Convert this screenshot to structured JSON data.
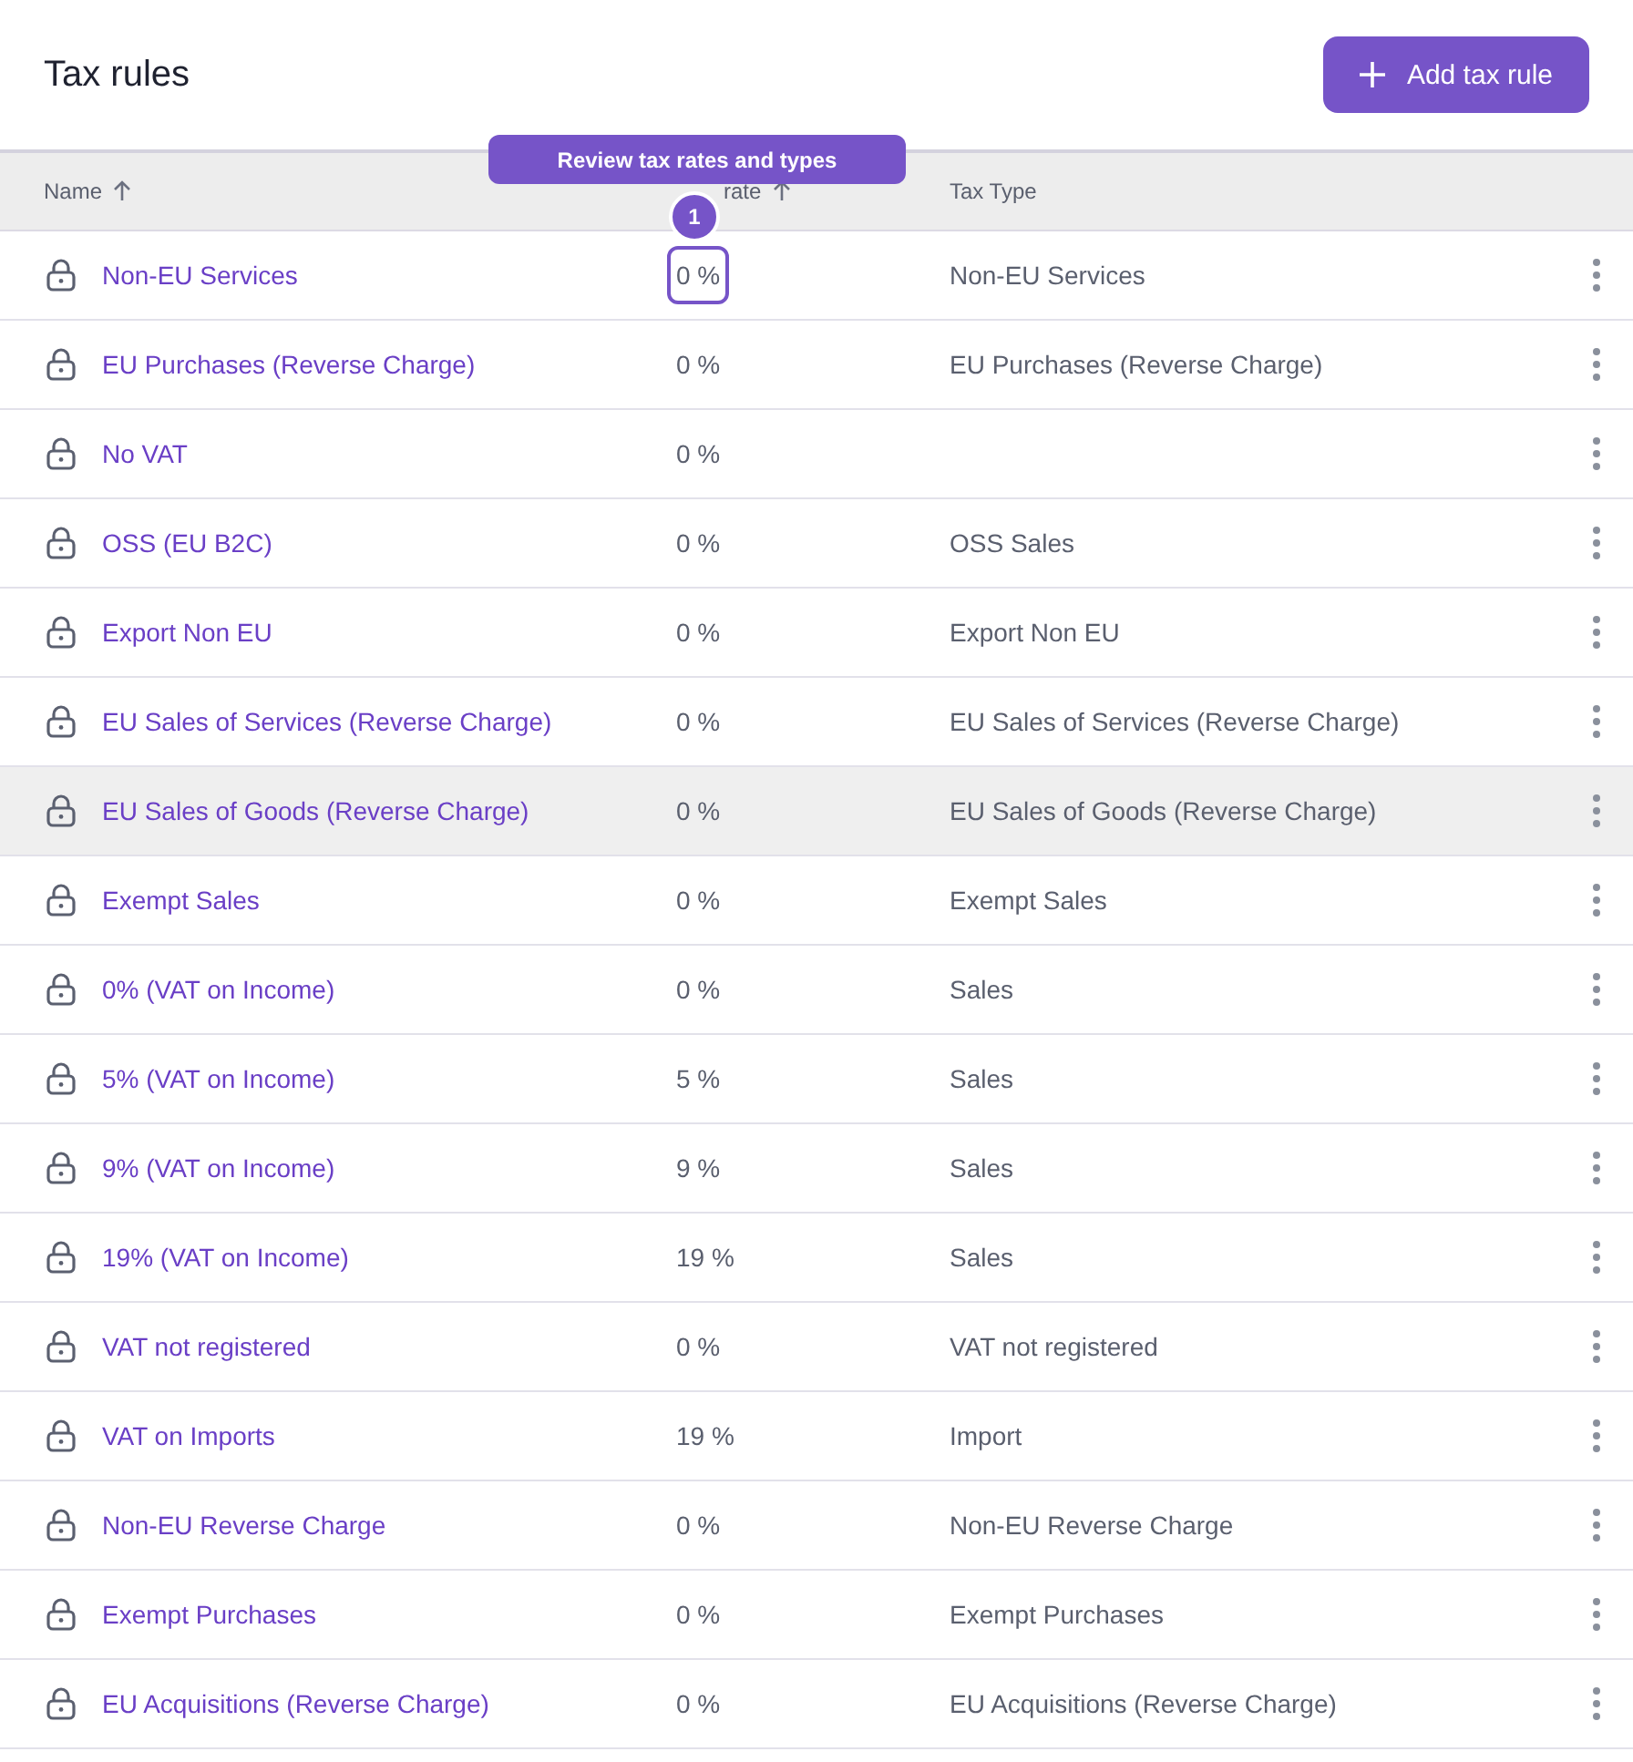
{
  "page": {
    "title": "Tax rules",
    "add_button": "Add tax rule"
  },
  "tour": {
    "tooltip": "Review tax rates and types",
    "step": "1"
  },
  "table": {
    "columns": [
      {
        "label": "Name",
        "sorted": true
      },
      {
        "label": "rate",
        "sorted": true
      },
      {
        "label": "Tax Type",
        "sorted": false
      }
    ],
    "rows": [
      {
        "name": "Non-EU Services",
        "rate": "0 %",
        "type": "Non-EU Services",
        "highlighted": false,
        "outlined": true
      },
      {
        "name": "EU Purchases (Reverse Charge)",
        "rate": "0 %",
        "type": "EU Purchases (Reverse Charge)",
        "highlighted": false,
        "outlined": false
      },
      {
        "name": "No VAT",
        "rate": "0 %",
        "highlighted": false,
        "outlined": false
      },
      {
        "name": "OSS (EU B2C)",
        "rate": "0 %",
        "type": "OSS Sales",
        "highlighted": false,
        "outlined": false
      },
      {
        "name": "Export Non EU",
        "rate": "0 %",
        "type": "Export Non EU",
        "highlighted": false,
        "outlined": false
      },
      {
        "name": "EU Sales of Services (Reverse Charge)",
        "rate": "0 %",
        "type": "EU Sales of Services (Reverse Charge)",
        "highlighted": false,
        "outlined": false
      },
      {
        "name": "EU Sales of Goods (Reverse Charge)",
        "rate": "0 %",
        "type": "EU Sales of Goods (Reverse Charge)",
        "highlighted": true,
        "outlined": false
      },
      {
        "name": "Exempt Sales",
        "rate": "0 %",
        "type": "Exempt Sales",
        "highlighted": false,
        "outlined": false
      },
      {
        "name": "0% (VAT on Income)",
        "rate": "0 %",
        "type": "Sales",
        "highlighted": false,
        "outlined": false
      },
      {
        "name": "5% (VAT on Income)",
        "rate": "5 %",
        "type": "Sales",
        "highlighted": false,
        "outlined": false
      },
      {
        "name": "9% (VAT on Income)",
        "rate": "9 %",
        "type": "Sales",
        "highlighted": false,
        "outlined": false
      },
      {
        "name": "19% (VAT on Income)",
        "rate": "19 %",
        "type": "Sales",
        "highlighted": false,
        "outlined": false
      },
      {
        "name": "VAT not registered",
        "rate": "0 %",
        "type": "VAT not registered",
        "highlighted": false,
        "outlined": false
      },
      {
        "name": "VAT on Imports",
        "rate": "19 %",
        "type": "Import",
        "highlighted": false,
        "outlined": false
      },
      {
        "name": "Non-EU Reverse Charge",
        "rate": "0 %",
        "type": "Non-EU Reverse Charge",
        "highlighted": false,
        "outlined": false
      },
      {
        "name": "Exempt Purchases",
        "rate": "0 %",
        "type": "Exempt Purchases",
        "highlighted": false,
        "outlined": false
      },
      {
        "name": "EU Acquisitions (Reverse Charge)",
        "rate": "0 %",
        "type": "EU Acquisitions (Reverse Charge)",
        "highlighted": false,
        "outlined": false
      }
    ]
  }
}
